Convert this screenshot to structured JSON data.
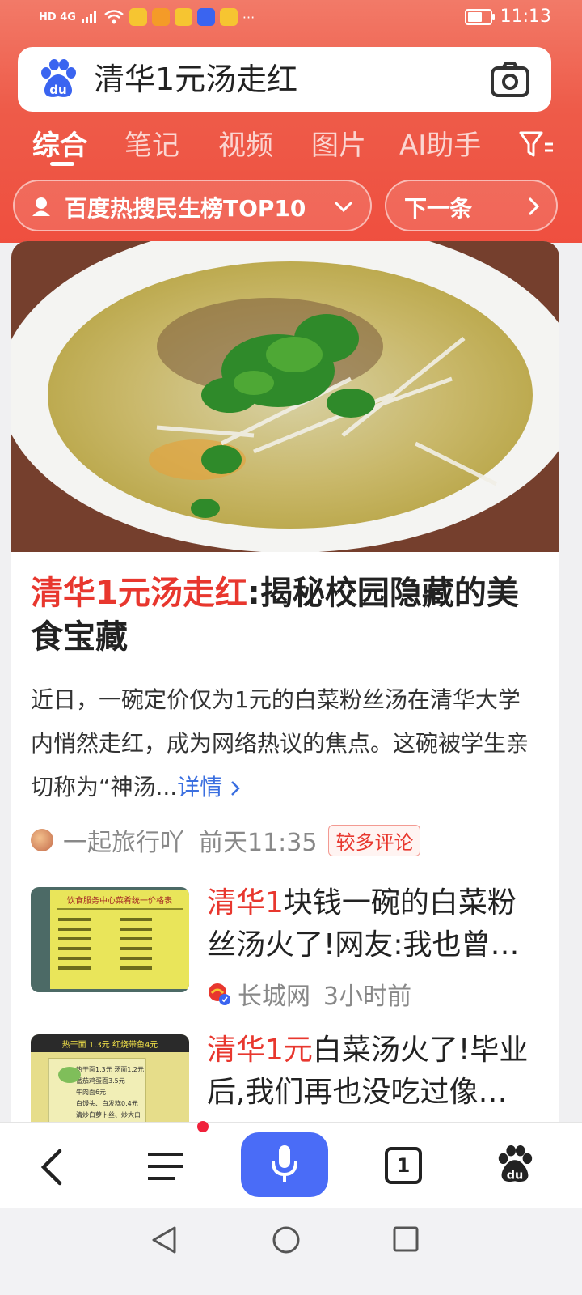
{
  "status_bar": {
    "network": "HD 4G",
    "more": "···",
    "battery_level": 0.75,
    "time": "11:13"
  },
  "search": {
    "query": "清华1元汤走红",
    "logo_text": "du"
  },
  "tabs": [
    {
      "label": "综合",
      "active": true
    },
    {
      "label": "笔记",
      "active": false
    },
    {
      "label": "视频",
      "active": false
    },
    {
      "label": "图片",
      "active": false
    },
    {
      "label": "AI助手",
      "active": false
    }
  ],
  "hot_list": {
    "label": "百度热搜民生榜TOP10",
    "next_label": "下一条"
  },
  "main_article": {
    "title_highlight": "清华1元汤走红",
    "title_rest": ":揭秘校园隐藏的美食宝藏",
    "summary": "近日，一碗定价仅为1元的白菜粉丝汤在清华大学内悄然走红，成为网络热议的焦点。这碗被学生亲切称为“神汤...",
    "detail_link": "详情",
    "author": "一起旅行吖",
    "time": "前天11:35",
    "badge": "较多评论"
  },
  "news": [
    {
      "title_highlight": "清华1",
      "title_rest": "块钱一碗的白菜粉丝汤火了!网友:我也曾…",
      "source": "长城网",
      "time": "3小时前",
      "thumb_heading": "饮食服务中心菜肴统一价格表"
    },
    {
      "title_highlight": "清华1元",
      "title_rest": "白菜汤火了!毕业后,我们再也没吃过像…",
      "thumb_heading": "热干面 1.3元 红烧带鱼4元",
      "thumb_lines": [
        "热干面1.3元 汤面1.2元",
        "番茄鸡蛋面3.5元",
        "牛肉面6元",
        "白馒头、白发糕0.4元",
        "清炒白萝卜丝、炒大白"
      ]
    }
  ],
  "bottom_bar": {
    "tab_count": "1"
  },
  "colors": {
    "brand_red": "#ee5b49",
    "highlight_red": "#e8372e",
    "link_blue": "#3b6fe0",
    "mic_blue": "#4a6cf7"
  }
}
